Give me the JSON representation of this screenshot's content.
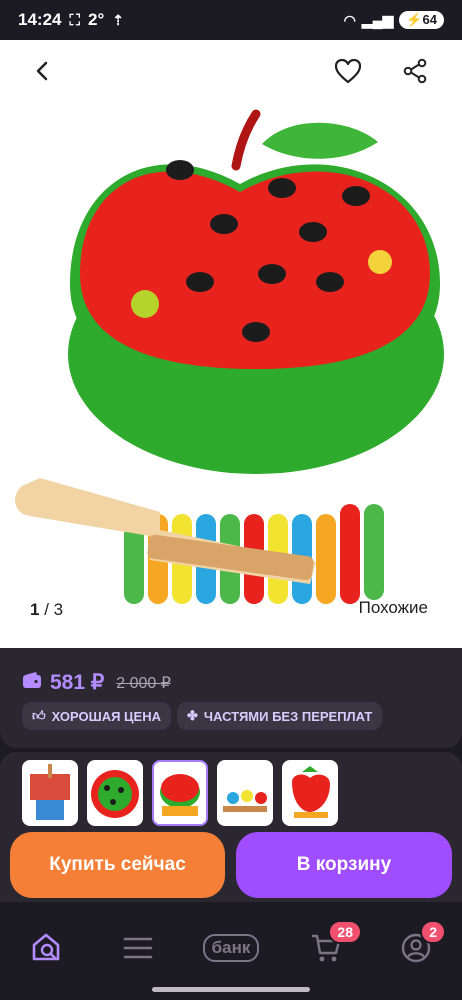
{
  "status": {
    "time": "14:24",
    "temp": "2°",
    "battery": "64"
  },
  "gallery": {
    "counter_current": "1",
    "counter_total": "/ 3",
    "similar_label": "Похожие"
  },
  "price": {
    "current": "581 ₽",
    "old": "2 000 ₽",
    "badges": [
      {
        "label": "ХОРОШАЯ ЦЕНА"
      },
      {
        "label": "ЧАСТЯМИ БЕЗ ПЕРЕПЛАТ"
      }
    ]
  },
  "actions": {
    "buy_label": "Купить сейчас",
    "cart_label": "В корзину"
  },
  "tabbar": {
    "bank_label": "банк",
    "cart_badge": "28",
    "profile_badge": "2"
  },
  "colors": {
    "accent_purple": "#9f4dff",
    "buy_orange": "#f57f37",
    "price_purple": "#b48cff",
    "badge_red": "#f2506f"
  }
}
